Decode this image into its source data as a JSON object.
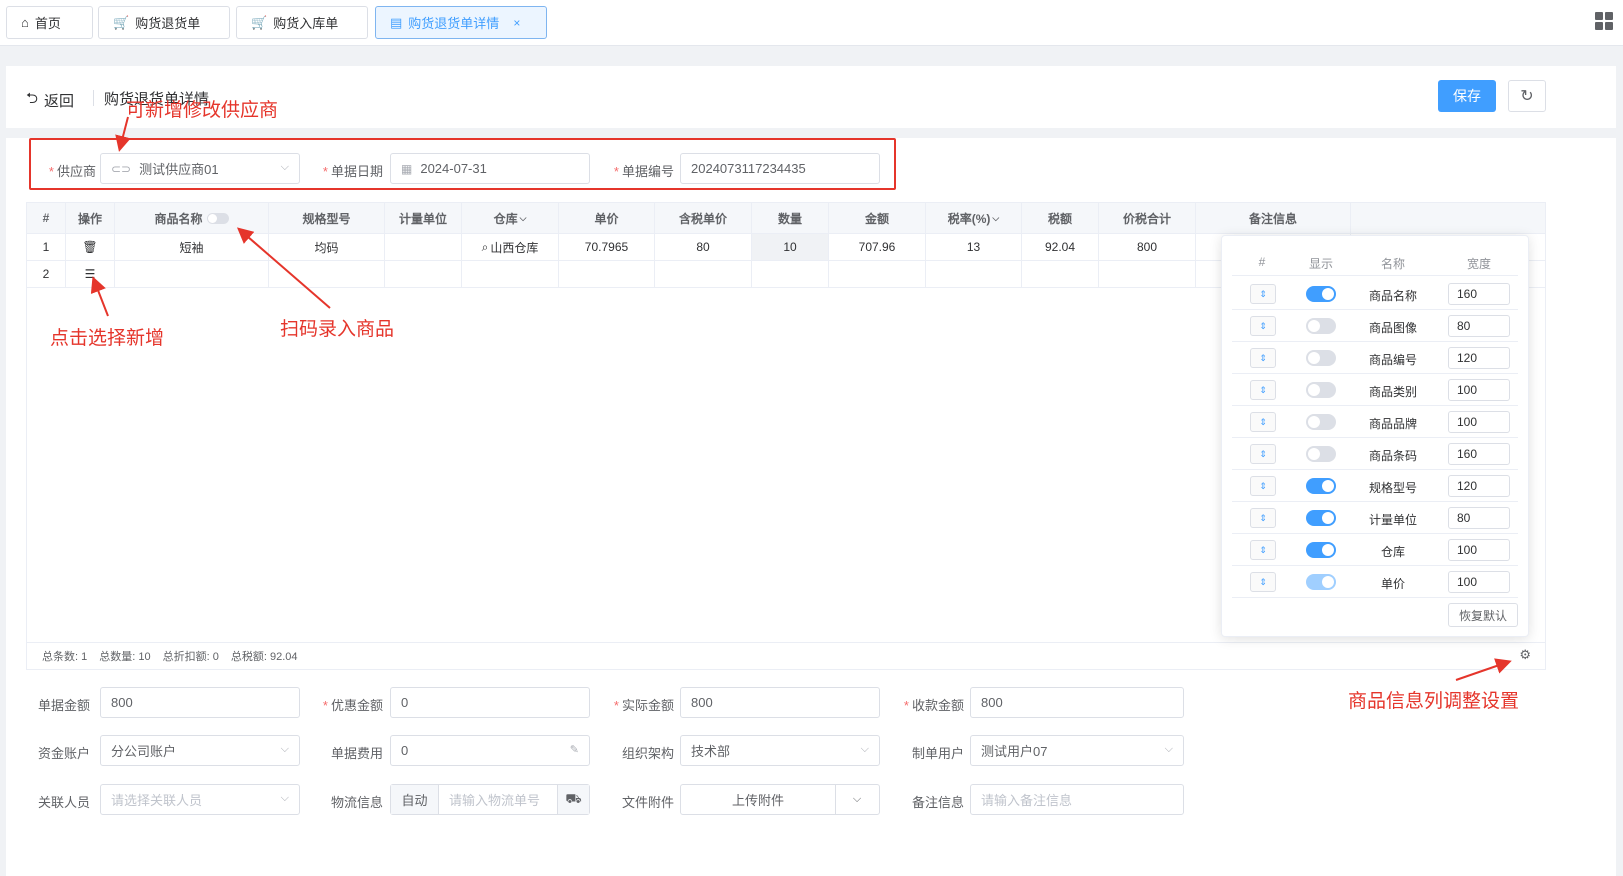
{
  "tabs": [
    {
      "label": "首页",
      "icon": "home-icon"
    },
    {
      "label": "购货退货单",
      "icon": "cart-icon"
    },
    {
      "label": "购货入库单",
      "icon": "cart-icon"
    },
    {
      "label": "购货退货单详情",
      "icon": "document-icon",
      "active": true
    }
  ],
  "header": {
    "back_label": "返回",
    "title": "购货退货单详情",
    "save_label": "保存"
  },
  "form_top": {
    "supplier_label": "供应商",
    "supplier_value": "测试供应商01",
    "date_label": "单据日期",
    "date_value": "2024-07-31",
    "number_label": "单据编号",
    "number_value": "2024073117234435"
  },
  "table": {
    "columns": [
      "#",
      "操作",
      "商品名称",
      "规格型号",
      "计量单位",
      "仓库",
      "单价",
      "含税单价",
      "数量",
      "金额",
      "税率(%)",
      "税额",
      "价税合计",
      "备注信息"
    ],
    "rows": [
      {
        "index": "1",
        "name": "短袖",
        "spec": "均码",
        "unit": "",
        "warehouse": "山西仓库",
        "price": "70.7965",
        "tax_price": "80",
        "qty": "10",
        "amount": "707.96",
        "tax_rate": "13",
        "tax": "92.04",
        "total": "800",
        "remark": ""
      },
      {
        "index": "2",
        "name": "",
        "spec": "",
        "unit": "",
        "warehouse": "",
        "price": "",
        "tax_price": "",
        "qty": "",
        "amount": "",
        "tax_rate": "",
        "tax": "",
        "total": "",
        "remark": ""
      }
    ],
    "summary": {
      "count_label": "总条数:",
      "count": "1",
      "qty_label": "总数量:",
      "qty": "10",
      "discount_label": "总折扣额:",
      "discount": "0",
      "tax_label": "总税额:",
      "tax": "92.04"
    }
  },
  "column_settings": {
    "headers": [
      "#",
      "显示",
      "名称",
      "宽度"
    ],
    "rows": [
      {
        "name": "商品名称",
        "width": "160",
        "show": "on"
      },
      {
        "name": "商品图像",
        "width": "80",
        "show": "off"
      },
      {
        "name": "商品编号",
        "width": "120",
        "show": "off"
      },
      {
        "name": "商品类别",
        "width": "100",
        "show": "off"
      },
      {
        "name": "商品品牌",
        "width": "100",
        "show": "off"
      },
      {
        "name": "商品条码",
        "width": "160",
        "show": "off"
      },
      {
        "name": "规格型号",
        "width": "120",
        "show": "on"
      },
      {
        "name": "计量单位",
        "width": "80",
        "show": "on"
      },
      {
        "name": "仓库",
        "width": "100",
        "show": "on"
      },
      {
        "name": "单价",
        "width": "100",
        "show": "light"
      }
    ],
    "reset_label": "恢复默认"
  },
  "form_bottom": {
    "doc_amount_label": "单据金额",
    "doc_amount": "800",
    "discount_label": "优惠金额",
    "discount": "0",
    "actual_label": "实际金额",
    "actual": "800",
    "receive_label": "收款金额",
    "receive": "800",
    "account_label": "资金账户",
    "account": "分公司账户",
    "fee_label": "单据费用",
    "fee": "0",
    "org_label": "组织架构",
    "org": "技术部",
    "creator_label": "制单用户",
    "creator": "测试用户07",
    "related_label": "关联人员",
    "related_placeholder": "请选择关联人员",
    "logistics_label": "物流信息",
    "logistics_mode": "自动",
    "logistics_placeholder": "请输入物流单号",
    "attach_label": "文件附件",
    "attach_button": "上传附件",
    "remark_label": "备注信息",
    "remark_placeholder": "请输入备注信息"
  },
  "annotations": {
    "supplier": "可新增修改供应商",
    "click_add": "点击选择新增",
    "scan": "扫码录入商品",
    "column_setting": "商品信息列调整设置"
  },
  "colors": {
    "primary": "#409eff",
    "annotation": "#e5352b"
  }
}
